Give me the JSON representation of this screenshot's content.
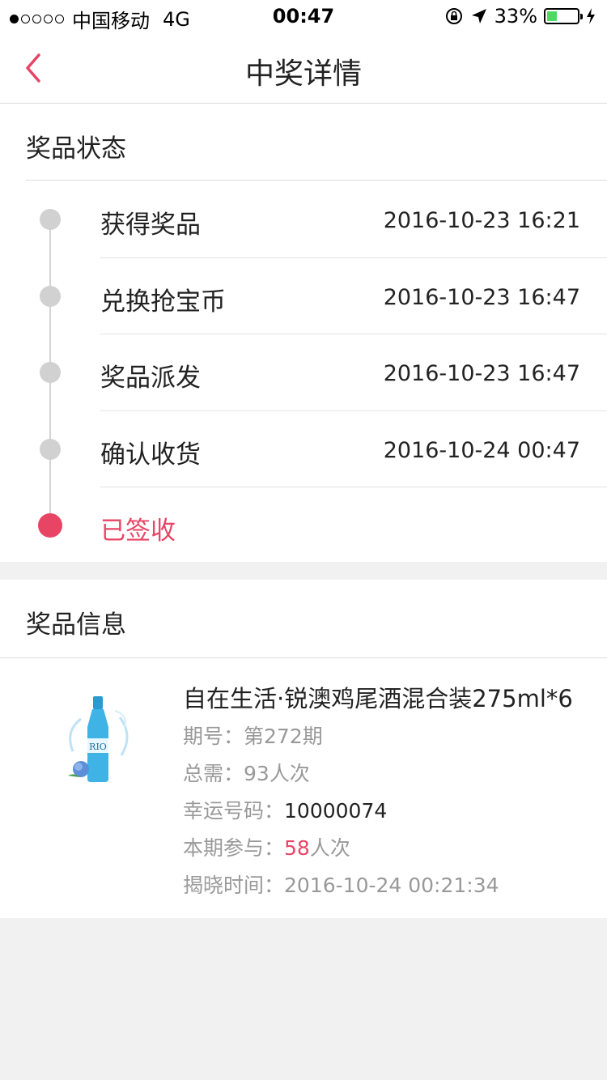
{
  "status_bar": {
    "carrier": "中国移动",
    "network": "4G",
    "time": "00:47",
    "battery": "33%",
    "battery_level": 0.33
  },
  "nav": {
    "title": "中奖详情"
  },
  "prize_status": {
    "title": "奖品状态",
    "steps": [
      {
        "label": "获得奖品",
        "time": "2016-10-23 16:21"
      },
      {
        "label": "兑换抢宝币",
        "time": "2016-10-23 16:47"
      },
      {
        "label": "奖品派发",
        "time": "2016-10-23 16:47"
      },
      {
        "label": "确认收货",
        "time": "2016-10-24 00:47"
      },
      {
        "label": "已签收",
        "time": ""
      }
    ]
  },
  "prize_info": {
    "title": "奖品信息",
    "name": "自在生活·锐澳鸡尾酒混合装275ml*6",
    "period_label": "期号：",
    "period_value": "第272期",
    "total_label": "总需：",
    "total_value": "93人次",
    "lucky_label": "幸运号码：",
    "lucky_value": "10000074",
    "participate_label": "本期参与：",
    "participate_count": "58",
    "participate_unit": "人次",
    "reveal_label": "揭晓时间：",
    "reveal_value": "2016-10-24 00:21:34",
    "bottle_brand": "RIO"
  },
  "colors": {
    "accent": "#e84565",
    "inactive_dot": "#d1d1d1",
    "background": "#f1f1f1"
  }
}
